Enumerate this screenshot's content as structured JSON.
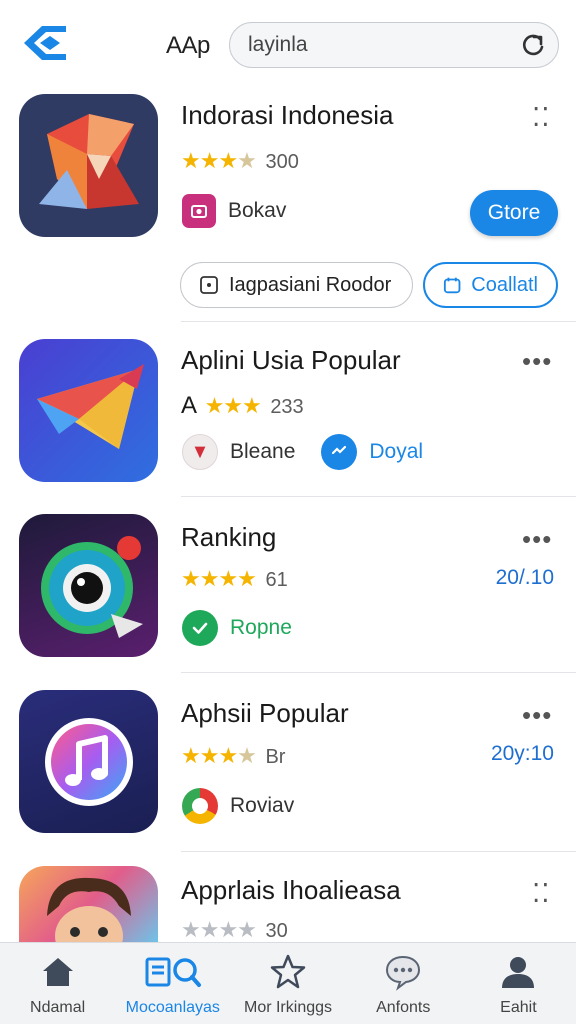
{
  "header": {
    "app_word": "AAp",
    "search_value": "layinla"
  },
  "apps": [
    {
      "title": "Indorasi Indonesia",
      "rating_prefix": "",
      "rating_count": "300",
      "developer": "Bokav",
      "button_label": "Gtore",
      "pill_left": "Iagpasiani Roodor",
      "pill_right": "Coallatl"
    },
    {
      "title": "Aplini Usia Popular",
      "rating_prefix": "A",
      "rating_count": "233",
      "developer": "Bleane",
      "developer2": "Doyal"
    },
    {
      "title": "Ranking",
      "rating_count": "61",
      "date": "20/.10",
      "developer": "Ropne"
    },
    {
      "title": "Aphsii Popular",
      "rating_count": "Br",
      "date": "20y:10",
      "developer": "Roviav"
    },
    {
      "title": "Apprlais Ihoalieasa",
      "rating_count": "30"
    }
  ],
  "bottom_nav": [
    {
      "label": "Ndamal",
      "icon": "home-icon"
    },
    {
      "label": "Mocoanlayas",
      "icon": "apps-search-icon"
    },
    {
      "label": "Mor Irkinggs",
      "icon": "star-icon"
    },
    {
      "label": "Anfonts",
      "icon": "chat-icon"
    },
    {
      "label": "Eahit",
      "icon": "person-icon"
    }
  ],
  "colors": {
    "accent": "#1a86e6",
    "star": "#f4b400",
    "divider": "#e2e4e8"
  }
}
